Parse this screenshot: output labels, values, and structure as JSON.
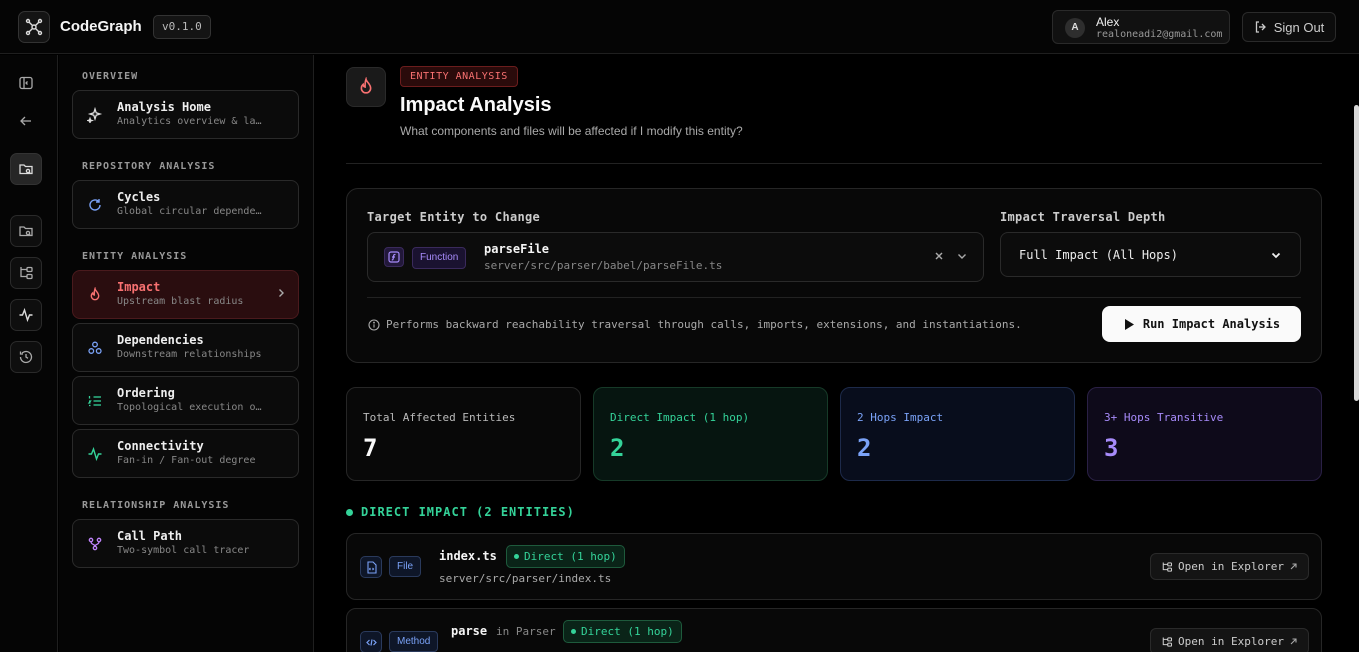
{
  "app": {
    "brand": "CodeGraph",
    "version": "v0.1.0"
  },
  "user": {
    "initial": "A",
    "name": "Alex",
    "email": "realoneadi2@gmail.com",
    "sign_out": "Sign Out"
  },
  "sidebar": {
    "sections": [
      {
        "title": "OVERVIEW"
      },
      {
        "title": "REPOSITORY ANALYSIS"
      },
      {
        "title": "ENTITY ANALYSIS"
      },
      {
        "title": "RELATIONSHIP ANALYSIS"
      }
    ],
    "items": [
      {
        "title": "Analysis Home",
        "subtitle": "Analytics overview & la…",
        "icon": "sparkles-icon"
      },
      {
        "title": "Cycles",
        "subtitle": "Global circular depende…",
        "icon": "refresh-icon"
      },
      {
        "title": "Impact",
        "subtitle": "Upstream blast radius",
        "icon": "flame-icon",
        "active": true
      },
      {
        "title": "Dependencies",
        "subtitle": "Downstream relationships",
        "icon": "network-icon"
      },
      {
        "title": "Ordering",
        "subtitle": "Topological execution o…",
        "icon": "list-ordered-icon"
      },
      {
        "title": "Connectivity",
        "subtitle": "Fan-in / Fan-out degree",
        "icon": "activity-icon"
      },
      {
        "title": "Call Path",
        "subtitle": "Two-symbol call tracer",
        "icon": "git-branch-icon"
      }
    ]
  },
  "header": {
    "badge": "ENTITY ANALYSIS",
    "title": "Impact Analysis",
    "subtitle": "What components and files will be affected if I modify this entity?"
  },
  "form": {
    "target_label": "Target Entity to Change",
    "entity_type": "Function",
    "entity_name": "parseFile",
    "entity_path": "server/src/parser/babel/parseFile.ts",
    "depth_label": "Impact Traversal Depth",
    "depth_value": "Full Impact (All Hops)",
    "info": "Performs backward reachability traversal through calls, imports, extensions, and instantiations.",
    "run_label": "Run Impact Analysis"
  },
  "stats": [
    {
      "label": "Total Affected Entities",
      "value": "7"
    },
    {
      "label": "Direct Impact (1 hop)",
      "value": "2"
    },
    {
      "label": "2 Hops Impact",
      "value": "2"
    },
    {
      "label": "3+ Hops Transitive",
      "value": "3"
    }
  ],
  "direct_section": "DIRECT IMPACT (2 ENTITIES)",
  "rows": [
    {
      "type": "File",
      "name": "index.ts",
      "in_label": "",
      "badge": "Direct (1 hop)",
      "path": "server/src/parser/index.ts",
      "action": "Open in Explorer"
    },
    {
      "type": "Method",
      "name": "parse",
      "in_label": "in Parser",
      "badge": "Direct (1 hop)",
      "path": "",
      "action": "Open in Explorer"
    }
  ],
  "colors": {
    "accent_red": "#f87171",
    "green": "#34d399",
    "blue": "#7aa2f7",
    "purple": "#a78bfa"
  }
}
